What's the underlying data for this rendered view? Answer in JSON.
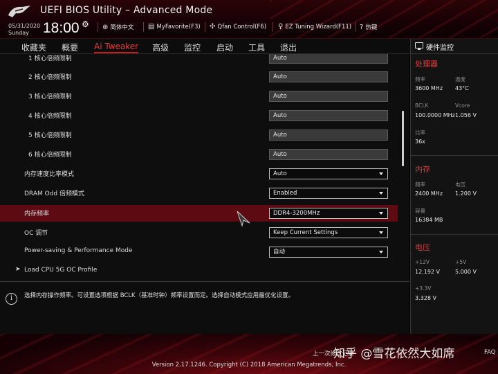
{
  "window": {
    "title": "UEFI BIOS Utility – Advanced Mode",
    "date": "05/31/2020",
    "day": "Sunday",
    "time": "18:00"
  },
  "toolbar": [
    {
      "icon": "globe-icon",
      "label": "简体中文"
    },
    {
      "icon": "keyboard-icon",
      "label": "MyFavorite(F3)"
    },
    {
      "icon": "fan-icon",
      "label": "Qfan Control(F6)"
    },
    {
      "icon": "bulb-icon",
      "label": "EZ Tuning Wizard(F11)"
    },
    {
      "icon": "help-icon",
      "label": "热键"
    }
  ],
  "menu": [
    "收藏夹",
    "概要",
    "Ai Tweaker",
    "高级",
    "监控",
    "启动",
    "工具",
    "退出"
  ],
  "active_menu": "Ai Tweaker",
  "settings": [
    {
      "label": "1 核心倍频限制",
      "value": "Auto",
      "type": "text"
    },
    {
      "label": "2 核心倍频限制",
      "value": "Auto",
      "type": "text"
    },
    {
      "label": "3 核心倍频限制",
      "value": "Auto",
      "type": "text"
    },
    {
      "label": "4 核心倍频限制",
      "value": "Auto",
      "type": "text"
    },
    {
      "label": "5 核心倍频限制",
      "value": "Auto",
      "type": "text"
    },
    {
      "label": "6 核心倍频限制",
      "value": "Auto",
      "type": "text"
    },
    {
      "label": "内存速度比率模式",
      "value": "Auto",
      "type": "dropdown"
    },
    {
      "label": "DRAM Odd 倍频模式",
      "value": "Enabled",
      "type": "dropdown"
    },
    {
      "label": "内存频率",
      "value": "DDR4-3200MHz",
      "type": "dropdown",
      "selected": true
    },
    {
      "label": "OC 调节",
      "value": "Keep Current Settings",
      "type": "dropdown"
    },
    {
      "label": "Power-saving & Performance Mode",
      "value": "自动",
      "type": "dropdown"
    },
    {
      "label": "Load CPU 5G OC Profile",
      "type": "submenu"
    }
  ],
  "help": {
    "text": "选择内存操作频率。可设置选项根据 BCLK（基准时钟）频率设置而定。选择自动模式应用最优化设置。"
  },
  "monitor": {
    "title": "硬件监控",
    "cpu": {
      "title": "处理器",
      "freq_label": "频率",
      "freq": "3600 MHz",
      "temp_label": "温度",
      "temp": "43°C",
      "bclk_label": "BCLK",
      "bclk": "100.0000 MHz",
      "vcore_label": "Vcore",
      "vcore": "1.056 V",
      "ratio_label": "比率",
      "ratio": "36x"
    },
    "memory": {
      "title": "内存",
      "freq_label": "频率",
      "freq": "2400 MHz",
      "volt_label": "电压",
      "volt": "1.200 V",
      "cap_label": "容量",
      "cap": "16384 MB"
    },
    "voltage": {
      "title": "电压",
      "v12_label": "+12V",
      "v12": "12.192 V",
      "v5_label": "+5V",
      "v5": "5.000 V",
      "v33_label": "+3.3V",
      "v33": "3.328 V"
    }
  },
  "footer": {
    "last_modified": "上一次修改记录",
    "faq": "FAQ",
    "watermark": "知乎 @雪花依然大如席",
    "version": "Version 2.17.1246. Copyright (C) 2018 American Megatrends, Inc."
  },
  "colors": {
    "accent": "#e23b3b",
    "selected_row": "#5e0a12",
    "background": "#0e0e0e"
  }
}
